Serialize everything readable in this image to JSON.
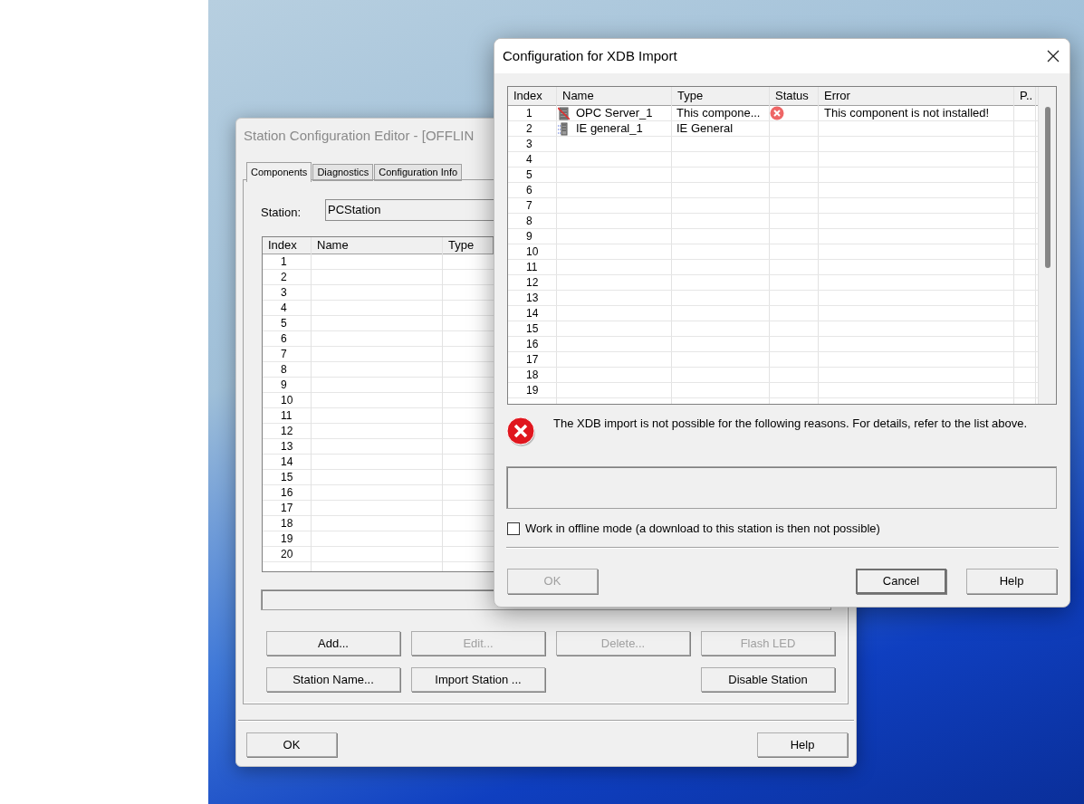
{
  "station_editor": {
    "title": "Station Configuration Editor - [OFFLIN",
    "tabs": [
      {
        "label": "Components",
        "selected": true
      },
      {
        "label": "Diagnostics",
        "selected": false
      },
      {
        "label": "Configuration Info",
        "selected": false
      }
    ],
    "station_label": "Station:",
    "station_value": "PCStation",
    "table": {
      "columns": [
        "Index",
        "Name",
        "Type"
      ],
      "rows": [
        "1",
        "2",
        "3",
        "4",
        "5",
        "6",
        "7",
        "8",
        "9",
        "10",
        "11",
        "12",
        "13",
        "14",
        "15",
        "16",
        "17",
        "18",
        "19",
        "20"
      ]
    },
    "buttons": [
      {
        "label": "Add...",
        "disabled": false
      },
      {
        "label": "Edit...",
        "disabled": true
      },
      {
        "label": "Delete...",
        "disabled": true
      },
      {
        "label": "Flash LED",
        "disabled": true
      },
      {
        "label": "Station Name...",
        "disabled": false
      },
      {
        "label": "Import Station ...",
        "disabled": false
      },
      {
        "label": "Disable Station",
        "disabled": false
      }
    ],
    "footer_buttons": [
      "OK",
      "Help"
    ]
  },
  "xdb_dialog": {
    "title": "Configuration for XDB Import",
    "table": {
      "columns": [
        "Index",
        "Name",
        "Type",
        "Status",
        "Error",
        "P.."
      ],
      "rows": [
        {
          "index": "1",
          "kind": "opc",
          "name": "OPC Server_1",
          "type": "This compone...",
          "error_status": true,
          "error": "This component is not installed!"
        },
        {
          "index": "2",
          "kind": "ethernet",
          "name": "IE general_1",
          "type": "IE General",
          "error_status": false
        },
        {
          "index": "3"
        },
        {
          "index": "4"
        },
        {
          "index": "5"
        },
        {
          "index": "6"
        },
        {
          "index": "7"
        },
        {
          "index": "8"
        },
        {
          "index": "9"
        },
        {
          "index": "10"
        },
        {
          "index": "11"
        },
        {
          "index": "12"
        },
        {
          "index": "13"
        },
        {
          "index": "14"
        },
        {
          "index": "15"
        },
        {
          "index": "16"
        },
        {
          "index": "17"
        },
        {
          "index": "18"
        },
        {
          "index": "19"
        }
      ]
    },
    "message": "The XDB import is not possible for the following reasons. For details, refer to the list above.",
    "offline_checkbox": {
      "label": "Work in offline mode (a download to this station is then not possible)",
      "checked": false
    },
    "buttons": [
      {
        "label": "OK",
        "disabled": true,
        "default": false
      },
      {
        "label": "Cancel",
        "disabled": false,
        "default": true
      },
      {
        "label": "Help",
        "disabled": false,
        "default": false
      }
    ]
  }
}
